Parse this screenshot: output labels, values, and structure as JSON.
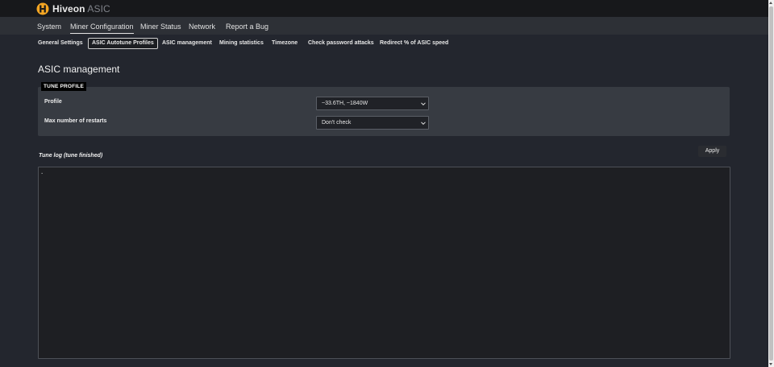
{
  "brand": {
    "name": "Hiveon",
    "suffix": "ASIC",
    "logo_icon": "hiveon-logo-icon",
    "accent": "#f5a623"
  },
  "main_nav": [
    {
      "label": "System",
      "active": false
    },
    {
      "label": "Miner Configuration",
      "active": true
    },
    {
      "label": "Miner Status",
      "active": false
    },
    {
      "label": "Network",
      "active": false
    },
    {
      "label": "Report a Bug",
      "active": false
    }
  ],
  "sub_nav": [
    {
      "label": "General Settings",
      "active": false
    },
    {
      "label": "ASIC Autotune Profiles",
      "active": true
    },
    {
      "label": "ASIC management",
      "active": false
    },
    {
      "label": "Mining statistics",
      "active": false
    },
    {
      "label": "Timezone",
      "active": false
    },
    {
      "label": "Check password attacks",
      "active": false
    },
    {
      "label": "Redirect % of ASIC speed",
      "active": false
    }
  ],
  "page": {
    "title": "ASIC management",
    "section_badge": "TUNE PROFILE"
  },
  "form": {
    "profile_label": "Profile",
    "profile_value": "~33.6TH, ~1840W",
    "restarts_label": "Max number of restarts",
    "restarts_value": "Don't check"
  },
  "log": {
    "title": "Tune log (tune finished)",
    "content": "."
  },
  "actions": {
    "apply_label": "Apply"
  },
  "icons": {
    "select_chevron": "chevron-down-icon"
  }
}
